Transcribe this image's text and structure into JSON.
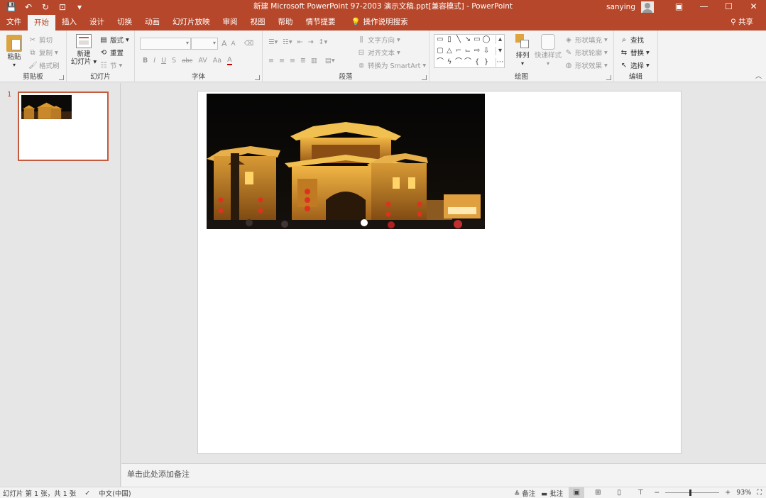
{
  "window": {
    "title": "新建 Microsoft PowerPoint 97-2003 演示文稿.ppt[兼容模式]  -  PowerPoint",
    "user": "sanying"
  },
  "quick_access": [
    "save-icon",
    "undo-icon",
    "redo-icon",
    "start-from-beginning-icon",
    "customize-icon"
  ],
  "tabs": [
    {
      "label": "文件"
    },
    {
      "label": "开始"
    },
    {
      "label": "插入"
    },
    {
      "label": "设计"
    },
    {
      "label": "切换"
    },
    {
      "label": "动画"
    },
    {
      "label": "幻灯片放映"
    },
    {
      "label": "审阅"
    },
    {
      "label": "视图"
    },
    {
      "label": "帮助"
    },
    {
      "label": "情节提要"
    }
  ],
  "tell_me": "操作说明搜索",
  "share": "共享",
  "ribbon": {
    "clipboard": {
      "label": "剪贴板",
      "paste": "粘贴",
      "cut": "剪切",
      "copy": "复制",
      "format_painter": "格式刷"
    },
    "slides": {
      "label": "幻灯片",
      "new_slide_1": "新建",
      "new_slide_2": "幻灯片",
      "layout": "版式",
      "reset": "重置",
      "section": "节"
    },
    "font": {
      "label": "字体",
      "bold": "B",
      "italic": "I",
      "underline": "U",
      "shadow": "S",
      "strike": "abc",
      "spacing": "AV",
      "case": "Aa",
      "color": "A",
      "grow": "A",
      "shrink": "A"
    },
    "paragraph": {
      "label": "段落",
      "text_direction": "文字方向",
      "align_text": "对齐文本",
      "smartart": "转换为 SmartArt"
    },
    "drawing": {
      "label": "绘图",
      "arrange": "排列",
      "quick_styles": "快速样式",
      "shape_fill": "形状填充",
      "shape_outline": "形状轮廓",
      "shape_effects": "形状效果"
    },
    "editing": {
      "label": "编辑",
      "find": "查找",
      "replace": "替换",
      "select": "选择"
    }
  },
  "thumbnails": [
    {
      "number": "1"
    }
  ],
  "notes_placeholder": "单击此处添加备注",
  "status": {
    "slide_info": "幻灯片 第 1 张，共 1 张",
    "language": "中文(中国)",
    "notes": "备注",
    "comments": "批注",
    "zoom": "93%"
  },
  "colors": {
    "accent": "#b7472a",
    "ribbon_bg": "#f3f3f3",
    "workspace_bg": "#e6e6e6"
  }
}
